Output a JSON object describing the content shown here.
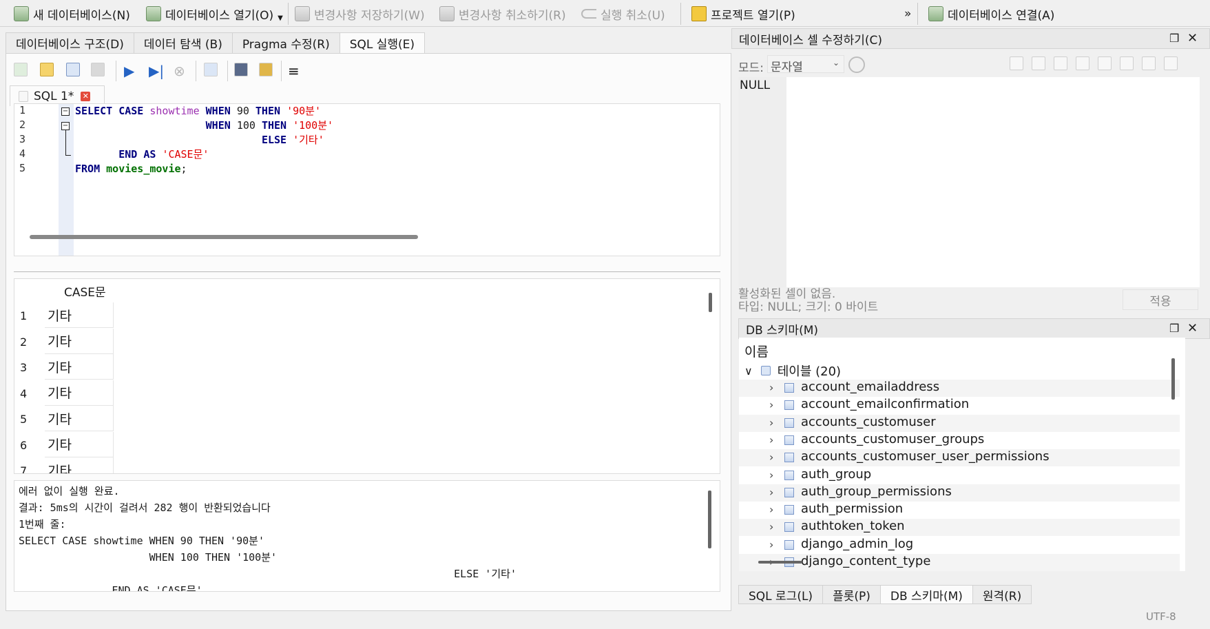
{
  "toolbar": {
    "new_db": "새 데이터베이스(N)",
    "open_db": "데이터베이스 열기(O)",
    "save_changes": "변경사항 저장하기(W)",
    "revert_changes": "변경사항 취소하기(R)",
    "undo": "실행 취소(U)",
    "open_project": "프로젝트 열기(P)",
    "overflow": "»",
    "attach_db": "데이터베이스 연결(A)"
  },
  "tabs": [
    "데이터베이스 구조(D)",
    "데이터 탐색 (B)",
    "Pragma 수정(R)",
    "SQL 실행(E)"
  ],
  "sql_tab": {
    "label": "SQL 1*",
    "close": "✕"
  },
  "editor": {
    "line_numbers": [
      "1",
      "2",
      "3",
      "4",
      "5"
    ],
    "lines": [
      "SELECT CASE showtime WHEN 90 THEN '90분'",
      "                     WHEN 100 THEN '100분'",
      "                              ELSE '기타'",
      "       END AS 'CASE문'",
      "FROM movies_movie;"
    ]
  },
  "results": {
    "column": "CASE문",
    "rows": [
      {
        "n": "1",
        "v": "기타"
      },
      {
        "n": "2",
        "v": "기타"
      },
      {
        "n": "3",
        "v": "기타"
      },
      {
        "n": "4",
        "v": "기타"
      },
      {
        "n": "5",
        "v": "기타"
      },
      {
        "n": "6",
        "v": "기타"
      },
      {
        "n": "7",
        "v": "기타"
      }
    ]
  },
  "log": {
    "lines": [
      "에러 없이 실행 완료.",
      "결과: 5ms의 시간이 걸려서 282 행이 반환되었습니다",
      "1번째 줄:",
      "SELECT CASE showtime WHEN 90 THEN '90분'",
      "                     WHEN 100 THEN '100분'",
      "                                                                      ELSE '기타'",
      "               END AS 'CASE문'"
    ]
  },
  "cell_editor": {
    "title": "데이터베이스 셀 수정하기(C)",
    "mode_label": "모드:",
    "mode_value": "문자열",
    "value": "NULL",
    "status_line1": "활성화된 셀이 없음.",
    "status_line2": "타입: NULL; 크기: 0 바이트",
    "apply": "적용"
  },
  "schema": {
    "title": "DB 스키마(M)",
    "header": "이름",
    "tables_node": "테이블 (20)",
    "tables": [
      "account_emailaddress",
      "account_emailconfirmation",
      "accounts_customuser",
      "accounts_customuser_groups",
      "accounts_customuser_user_permissions",
      "auth_group",
      "auth_group_permissions",
      "auth_permission",
      "authtoken_token",
      "django_admin_log",
      "django_content_type"
    ]
  },
  "bottom_tabs": [
    "SQL 로그(L)",
    "플롯(P)",
    "DB 스키마(M)",
    "원격(R)"
  ],
  "statusbar": {
    "encoding": "UTF-8"
  }
}
